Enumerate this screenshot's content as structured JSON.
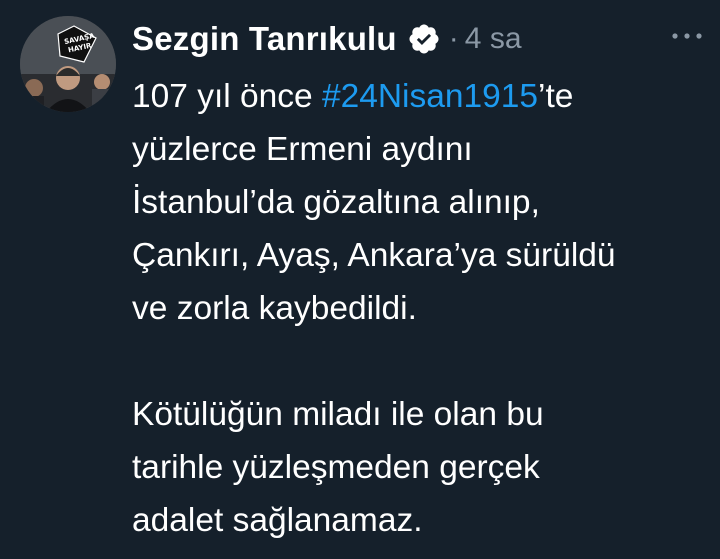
{
  "tweet": {
    "author": {
      "display_name": "Sezgin Tanrıkulu",
      "verified": true,
      "avatar_sign_text": [
        "SAVAŞA",
        "HAYIR"
      ]
    },
    "separator": "·",
    "time": "4 sa",
    "more_icon": "more-horizontal-icon",
    "paragraphs": [
      {
        "lines": [
          {
            "pre": "107 yıl önce ",
            "hashtag": "#24Nisan1915",
            "post": "’te"
          },
          {
            "text": "yüzlerce Ermeni aydını"
          },
          {
            "text": "İstanbul’da gözaltına alınıp,"
          },
          {
            "text": "Çankırı, Ayaş, Ankara’ya sürüldü"
          },
          {
            "text": "ve zorla kaybedildi."
          }
        ]
      },
      {
        "lines": [
          {
            "text": "Kötülüğün miladı ile olan bu"
          },
          {
            "text": "tarihle yüzleşmeden gerçek"
          },
          {
            "text": "adalet sağlanamaz."
          }
        ]
      }
    ]
  },
  "colors": {
    "background": "#15202b",
    "text": "#ffffff",
    "secondary": "#8b98a5",
    "link": "#1d9bf0"
  }
}
